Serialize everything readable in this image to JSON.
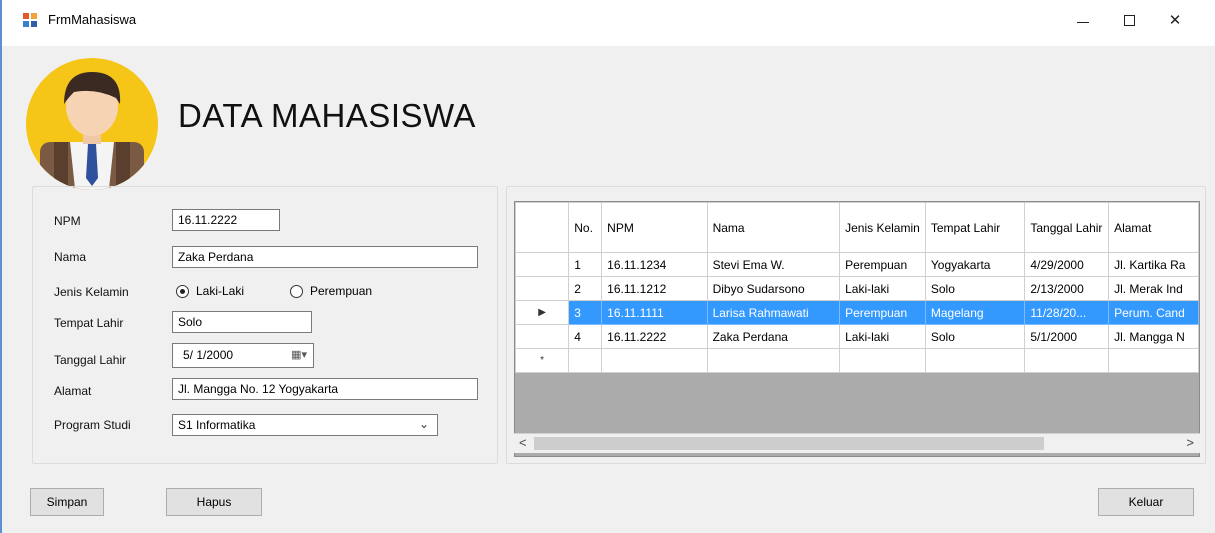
{
  "window": {
    "title": "FrmMahasiswa",
    "min_glyph": "",
    "max_glyph": "",
    "close_glyph": "✕"
  },
  "page_title": "DATA MAHASISWA",
  "form": {
    "npm": {
      "label": "NPM",
      "value": "16.11.2222"
    },
    "nama": {
      "label": "Nama",
      "value": "Zaka Perdana"
    },
    "jenis_kelamin": {
      "label": "Jenis Kelamin",
      "options": [
        {
          "label": "Laki-Laki",
          "checked": true
        },
        {
          "label": "Perempuan",
          "checked": false
        }
      ]
    },
    "tempat_lahir": {
      "label": "Tempat Lahir",
      "value": "Solo"
    },
    "tanggal_lahir": {
      "label": "Tanggal Lahir",
      "value": "5/ 1/2000",
      "icon": "calendar-dropdown-icon"
    },
    "alamat": {
      "label": "Alamat",
      "value": "Jl. Mangga No. 12 Yogyakarta"
    },
    "program_studi": {
      "label": "Program Studi",
      "value": "S1 Informatika"
    }
  },
  "grid": {
    "columns": [
      "No.",
      "NPM",
      "Nama",
      "Jenis Kelamin",
      "Tempat Lahir",
      "Tanggal Lahir",
      "Alamat"
    ],
    "rows": [
      {
        "marker": "",
        "cells": [
          "1",
          "16.11.1234",
          "Stevi Ema W.",
          "Perempuan",
          "Yogyakarta",
          "4/29/2000",
          "Jl. Kartika Ra"
        ]
      },
      {
        "marker": "",
        "cells": [
          "2",
          "16.11.1212",
          "Dibyo Sudarsono",
          "Laki-laki",
          "Solo",
          "2/13/2000",
          "Jl. Merak Ind"
        ]
      },
      {
        "marker": "▶",
        "cells": [
          "3",
          "16.11.1111",
          "Larisa Rahmawati",
          "Perempuan",
          "Magelang",
          "11/28/20...",
          "Perum. Cand"
        ],
        "selected": true
      },
      {
        "marker": "",
        "cells": [
          "4",
          "16.11.2222",
          "Zaka Perdana",
          "Laki-laki",
          "Solo",
          "5/1/2000",
          "Jl. Mangga N"
        ]
      },
      {
        "marker": "*",
        "cells": [
          "",
          "",
          "",
          "",
          "",
          "",
          ""
        ]
      }
    ],
    "scroll_left": "<",
    "scroll_right": ">"
  },
  "buttons": {
    "simpan": "Simpan",
    "hapus": "Hapus",
    "keluar": "Keluar"
  },
  "colors": {
    "selection": "#3399ff",
    "avatar_bg": "#f5c518"
  }
}
